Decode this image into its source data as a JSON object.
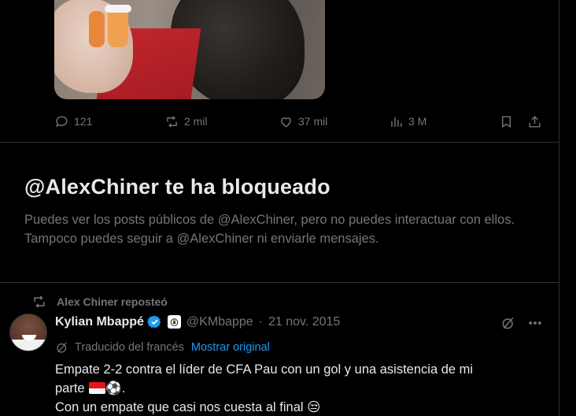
{
  "post": {
    "replies": "121",
    "reposts": "2 mil",
    "likes": "37 mil",
    "views": "3 M"
  },
  "blocked": {
    "title": "@AlexChiner te ha bloqueado",
    "description": "Puedes ver los posts públicos de @AlexChiner, pero no puedes interactuar con ellos. Tampoco puedes seguir a @AlexChiner ni enviarle mensajes."
  },
  "tweet": {
    "repost_label": "Alex Chiner reposteó",
    "author_name": "Kylian Mbappé",
    "handle": "@KMbappe",
    "separator": "·",
    "date": "21 nov. 2015",
    "translated_label": "Traducido del francés",
    "show_original": "Mostrar original",
    "text_line1": "Empate 2-2 contra el líder de CFA Pau con un gol y una asistencia de mi",
    "text_line2a": "parte",
    "text_line2_ball": "⚽",
    "text_line2b": ".",
    "text_line3": "Con un empate que casi nos cuesta al final",
    "text_line3_emoji": "😒"
  },
  "colors": {
    "background": "#000000",
    "text": "#e7e9ea",
    "muted": "#71767b",
    "accent": "#1d9bf0",
    "border": "#2f3336"
  }
}
